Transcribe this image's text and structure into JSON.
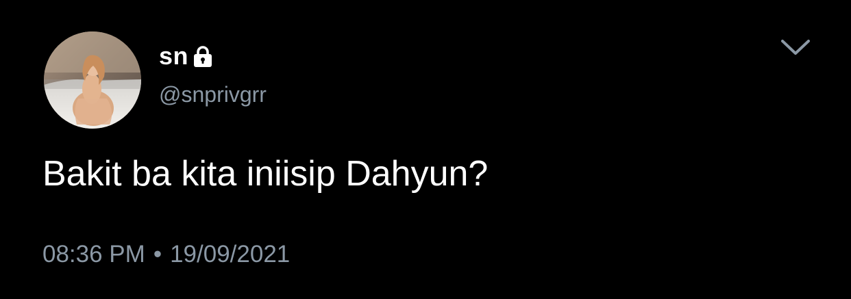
{
  "tweet": {
    "display_name": "sn",
    "handle": "@snprivgrr",
    "text": "Bakit ba kita iniisip Dahyun?",
    "time": "08:36 PM",
    "separator": "•",
    "date": "19/09/2021",
    "protected_icon": "lock-icon",
    "menu_icon": "chevron-down-icon",
    "avatar": "profile-photo"
  },
  "colors": {
    "background": "#000000",
    "primary_text": "#ffffff",
    "secondary_text": "#8b98a5"
  }
}
